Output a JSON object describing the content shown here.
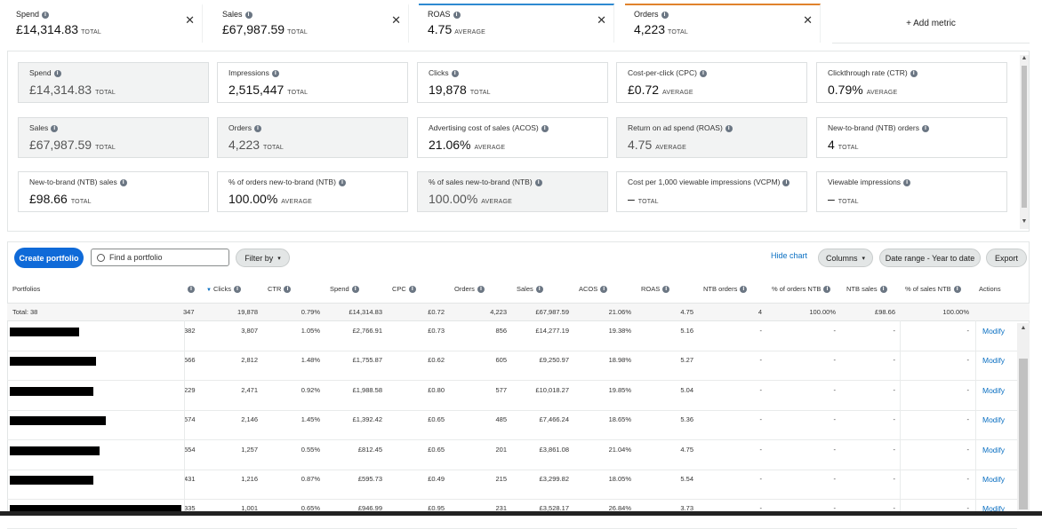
{
  "tabs": [
    {
      "label": "Spend",
      "value": "£14,314.83",
      "unit": "TOTAL",
      "color": ""
    },
    {
      "label": "Sales",
      "value": "£67,987.59",
      "unit": "TOTAL",
      "color": ""
    },
    {
      "label": "ROAS",
      "value": "4.75",
      "unit": "AVERAGE",
      "color": "#2f8ad1"
    },
    {
      "label": "Orders",
      "value": "4,223",
      "unit": "TOTAL",
      "color": "#e0822c"
    }
  ],
  "add_metric": "+ Add metric",
  "metrics": [
    {
      "label": "Spend",
      "value": "£14,314.83",
      "unit": "TOTAL",
      "selected": true
    },
    {
      "label": "Impressions",
      "value": "2,515,447",
      "unit": "TOTAL",
      "selected": false
    },
    {
      "label": "Clicks",
      "value": "19,878",
      "unit": "TOTAL",
      "selected": false
    },
    {
      "label": "Cost-per-click (CPC)",
      "value": "£0.72",
      "unit": "AVERAGE",
      "selected": false
    },
    {
      "label": "Clickthrough rate (CTR)",
      "value": "0.79%",
      "unit": "AVERAGE",
      "selected": false
    },
    {
      "label": "Sales",
      "value": "£67,987.59",
      "unit": "TOTAL",
      "selected": true
    },
    {
      "label": "Orders",
      "value": "4,223",
      "unit": "TOTAL",
      "selected": true
    },
    {
      "label": "Advertising cost of sales (ACOS)",
      "value": "21.06%",
      "unit": "AVERAGE",
      "selected": false
    },
    {
      "label": "Return on ad spend (ROAS)",
      "value": "4.75",
      "unit": "AVERAGE",
      "selected": true
    },
    {
      "label": "New-to-brand (NTB) orders",
      "value": "4",
      "unit": "TOTAL",
      "selected": false
    },
    {
      "label": "New-to-brand (NTB) sales",
      "value": "£98.66",
      "unit": "TOTAL",
      "selected": false
    },
    {
      "label": "% of orders new-to-brand (NTB)",
      "value": "100.00%",
      "unit": "AVERAGE",
      "selected": false
    },
    {
      "label": "% of sales new-to-brand (NTB)",
      "value": "100.00%",
      "unit": "AVERAGE",
      "selected": true
    },
    {
      "label": "Cost per 1,000 viewable impressions (VCPM)",
      "value": "–",
      "unit": "TOTAL",
      "selected": false
    },
    {
      "label": "Viewable impressions",
      "value": "–",
      "unit": "TOTAL",
      "selected": false
    }
  ],
  "toolbar": {
    "create": "Create portfolio",
    "search_placeholder": "Find a portfolio",
    "filter": "Filter by",
    "hide_chart": "Hide chart",
    "columns": "Columns",
    "date_range": "Date range - Year to date",
    "export": "Export"
  },
  "table": {
    "headers": [
      "Portfolios",
      "Clicks",
      "CTR",
      "Spend",
      "CPC",
      "Orders",
      "Sales",
      "ACOS",
      "ROAS",
      "NTB orders",
      "% of orders NTB",
      "NTB sales",
      "% of sales NTB",
      "Actions"
    ],
    "total": {
      "label": "Total: 38",
      "clip": "347",
      "cells": [
        "19,878",
        "0.79%",
        "£14,314.83",
        "£0.72",
        "4,223",
        "£67,987.59",
        "21.06%",
        "4.75",
        "4",
        "100.00%",
        "£98.66",
        "100.00%"
      ]
    },
    "rows": [
      {
        "clip": "382",
        "cells": [
          "3,807",
          "1.05%",
          "£2,766.91",
          "£0.73",
          "856",
          "£14,277.19",
          "19.38%",
          "5.16",
          "-",
          "-",
          "-",
          "-"
        ],
        "action": "Modify"
      },
      {
        "clip": "566",
        "cells": [
          "2,812",
          "1.48%",
          "£1,755.87",
          "£0.62",
          "605",
          "£9,250.97",
          "18.98%",
          "5.27",
          "-",
          "-",
          "-",
          "-"
        ],
        "action": "Modify"
      },
      {
        "clip": "229",
        "cells": [
          "2,471",
          "0.92%",
          "£1,988.58",
          "£0.80",
          "577",
          "£10,018.27",
          "19.85%",
          "5.04",
          "-",
          "-",
          "-",
          "-"
        ],
        "action": "Modify"
      },
      {
        "clip": "574",
        "cells": [
          "2,146",
          "1.45%",
          "£1,392.42",
          "£0.65",
          "485",
          "£7,466.24",
          "18.65%",
          "5.36",
          "-",
          "-",
          "-",
          "-"
        ],
        "action": "Modify"
      },
      {
        "clip": "554",
        "cells": [
          "1,257",
          "0.55%",
          "£812.45",
          "£0.65",
          "201",
          "£3,861.08",
          "21.04%",
          "4.75",
          "-",
          "-",
          "-",
          "-"
        ],
        "action": "Modify"
      },
      {
        "clip": "431",
        "cells": [
          "1,216",
          "0.87%",
          "£595.73",
          "£0.49",
          "215",
          "£3,299.82",
          "18.05%",
          "5.54",
          "-",
          "-",
          "-",
          "-"
        ],
        "action": "Modify"
      },
      {
        "clip": "335",
        "cells": [
          "1,001",
          "0.65%",
          "£946.99",
          "£0.95",
          "231",
          "£3,528.17",
          "26.84%",
          "3.73",
          "-",
          "-",
          "-",
          "-"
        ],
        "action": "Modify"
      }
    ]
  }
}
